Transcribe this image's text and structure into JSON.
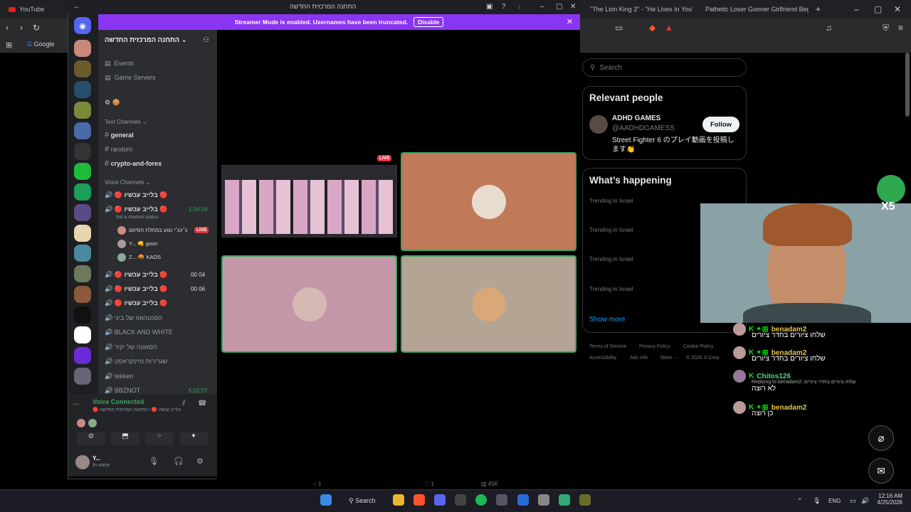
{
  "browser": {
    "tabs": [
      {
        "title": "YouTube"
      },
      {
        "title": "\"The Lion King 2\" - \"He Lives In You\""
      },
      {
        "title": "Pathetic Loser Gooner Girlfriend Beg"
      }
    ],
    "bookmark": "Google"
  },
  "x": {
    "search_placeholder": "Search",
    "relevant_title": "Relevant people",
    "person": {
      "name": "ADHD GAMES",
      "handle": "@AADHDGAMESS",
      "bio": "Street Fighter 6 のプレイ動画を投稿します👏",
      "follow": "Follow"
    },
    "happening_title": "What’s happening",
    "trends": [
      "Trending in Israel",
      "Trending in Israel",
      "Trending in Israel",
      "Trending in Israel"
    ],
    "show_more": "Show more",
    "footer": [
      "Terms of Service",
      "Privacy Policy",
      "Cookie Policy",
      "Accessibility",
      "Ads info",
      "More ···",
      "© 2026 X Corp."
    ],
    "stats": {
      "replies": "1",
      "likes": "1",
      "views": "45K"
    }
  },
  "discord": {
    "window_title": "התחנה המרכזית החדשה",
    "streamer_text": "Streamer Mode is enabled. Usernames have been truncated.",
    "disable_label": "Disable",
    "server_name": "התחנה המרכזית החדשה",
    "events": "Events",
    "game_servers": "Game Servers",
    "text_channels": "Text Channels",
    "channels": [
      "general",
      "random",
      "crypto-and-forex"
    ],
    "voice_channels": "Voice Channels",
    "voice": [
      {
        "name": "🔴 בלייב עכשיו 🔴",
        "time": ""
      },
      {
        "name": "🔴 בלייב עכשיו 🔴",
        "time": "1:34:16",
        "status": "Set a channel status"
      },
      {
        "name": "🔴 בלייב עכשיו 🔴",
        "time": "00 04"
      },
      {
        "name": "🔴 בלייב עכשיו 🔴",
        "time": "00 06"
      },
      {
        "name": "🔴 בלייב עכשיו 🔴",
        "time": ""
      },
      {
        "name": "הפנטהאוז של ביני",
        "time": ""
      },
      {
        "name": "BLACK AND WHITE",
        "time": ""
      },
      {
        "name": "הסאונה של יקיר",
        "time": ""
      },
      {
        "name": "שגרירות מיינקראפט",
        "time": ""
      },
      {
        "name": "tekken",
        "time": ""
      },
      {
        "name": "BBZNOT",
        "time": "5:02:57"
      }
    ],
    "voice_users": [
      {
        "name": "ג׳ינג׳י נגוע במחלת הסיזום",
        "badge": "LIVE"
      },
      {
        "name": "Y... 👊 goon"
      },
      {
        "name": "Z... 🤬 KAOS"
      }
    ],
    "live_badge": "LIVE",
    "voice_connected": "Voice Connected",
    "voice_sub": "🔴 בלייב עכשיו 🔴 / התחנה המרכזית החדשה",
    "user_name": "Y...",
    "user_status": "In voice"
  },
  "stream_chat": [
    {
      "name": "benadam2",
      "msg": "שלחו ציורים בחדר ציורים"
    },
    {
      "name": "benadam2",
      "msg": "שלחו ציורים בחדר ציורים"
    },
    {
      "name": "Chitos126",
      "reply": "Replying to benadam2: שלחו ציורים בחדר ציורים",
      "msg": "לא רוצה"
    },
    {
      "name": "benadam2",
      "msg": "כן רוצה"
    }
  ],
  "taskbar": {
    "search": "Search",
    "lang": "ENG",
    "time": "12:16 AM",
    "date": "4/25/2026"
  },
  "overlay": {
    "multiplier": "X5"
  }
}
